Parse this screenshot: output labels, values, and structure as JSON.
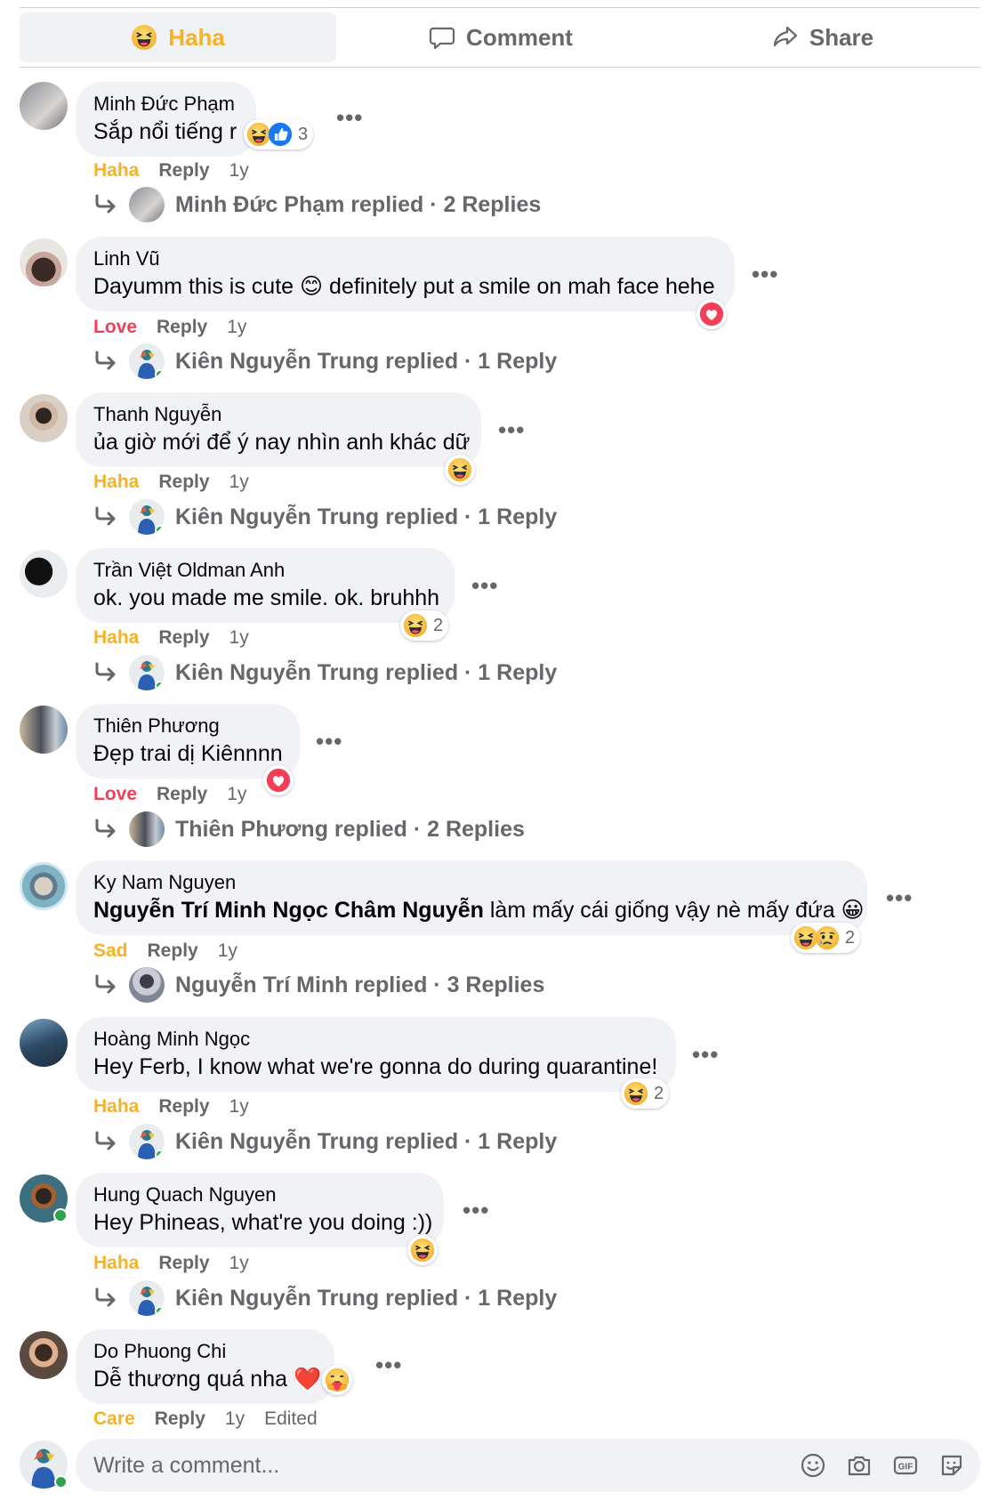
{
  "action_bar": {
    "haha_label": "Haha",
    "comment_label": "Comment",
    "share_label": "Share"
  },
  "comments": [
    {
      "author": "Minh Đức Phạm",
      "text": "Sắp nổi tiếng r",
      "reaction_label": "Haha",
      "reaction_count": "3",
      "reply_label": "Reply",
      "time": "1y",
      "replies_summary": "Minh Đức Phạm replied · 2 Replies"
    },
    {
      "author": "Linh Vũ",
      "text": "Dayumm this is cute 😊 definitely put a smile on mah face hehe",
      "reaction_label": "Love",
      "reaction_count": "",
      "reply_label": "Reply",
      "time": "1y",
      "replies_summary": "Kiên Nguyễn Trung replied · 1 Reply"
    },
    {
      "author": "Thanh Nguyễn",
      "text": "ủa giờ mới để ý nay nhìn anh khác dữ",
      "reaction_label": "Haha",
      "reaction_count": "",
      "reply_label": "Reply",
      "time": "1y",
      "replies_summary": "Kiên Nguyễn Trung replied · 1 Reply"
    },
    {
      "author": "Trần Việt Oldman Anh",
      "text": "ok. you made me smile. ok. bruhhh",
      "reaction_label": "Haha",
      "reaction_count": "2",
      "reply_label": "Reply",
      "time": "1y",
      "replies_summary": "Kiên Nguyễn Trung replied · 1 Reply"
    },
    {
      "author": "Thiên Phương",
      "text": "Đẹp trai dị Kiênnnn",
      "reaction_label": "Love",
      "reaction_count": "",
      "reply_label": "Reply",
      "time": "1y",
      "replies_summary": "Thiên Phương replied · 2 Replies"
    },
    {
      "author": "Ky Nam Nguyen",
      "mention": "Nguyễn Trí Minh Ngọc Châm Nguyễn",
      "text": " làm mấy cái giống vậy nè mấy đứa 😀",
      "reaction_label": "Sad",
      "reaction_count": "2",
      "reply_label": "Reply",
      "time": "1y",
      "replies_summary": "Nguyễn Trí Minh replied · 3 Replies"
    },
    {
      "author": "Hoàng Minh Ngọc",
      "text": "Hey Ferb, I know what we're gonna do during quarantine!",
      "reaction_label": "Haha",
      "reaction_count": "2",
      "reply_label": "Reply",
      "time": "1y",
      "replies_summary": "Kiên Nguyễn Trung replied · 1 Reply"
    },
    {
      "author": "Hung Quach Nguyen",
      "text": "Hey Phineas, what're you doing :))",
      "reaction_label": "Haha",
      "reaction_count": "",
      "reply_label": "Reply",
      "time": "1y",
      "replies_summary": "Kiên Nguyễn Trung replied · 1 Reply"
    },
    {
      "author": "Do Phuong Chi",
      "text": "Dễ thương quá nha ❤️",
      "reaction_label": "Care",
      "reaction_count": "",
      "reply_label": "Reply",
      "time": "1y",
      "edited_label": "Edited"
    }
  ],
  "composer": {
    "placeholder": "Write a comment..."
  },
  "icons": {
    "haha": "haha-emoji-icon",
    "love": "love-heart-icon",
    "like": "like-thumb-icon",
    "sad": "sad-emoji-icon",
    "care": "care-emoji-icon"
  },
  "colors": {
    "haha": "#f7b125",
    "love": "#f33e58",
    "secondary_text": "#65676b",
    "bubble": "#f0f2f5",
    "online": "#31a24c"
  }
}
